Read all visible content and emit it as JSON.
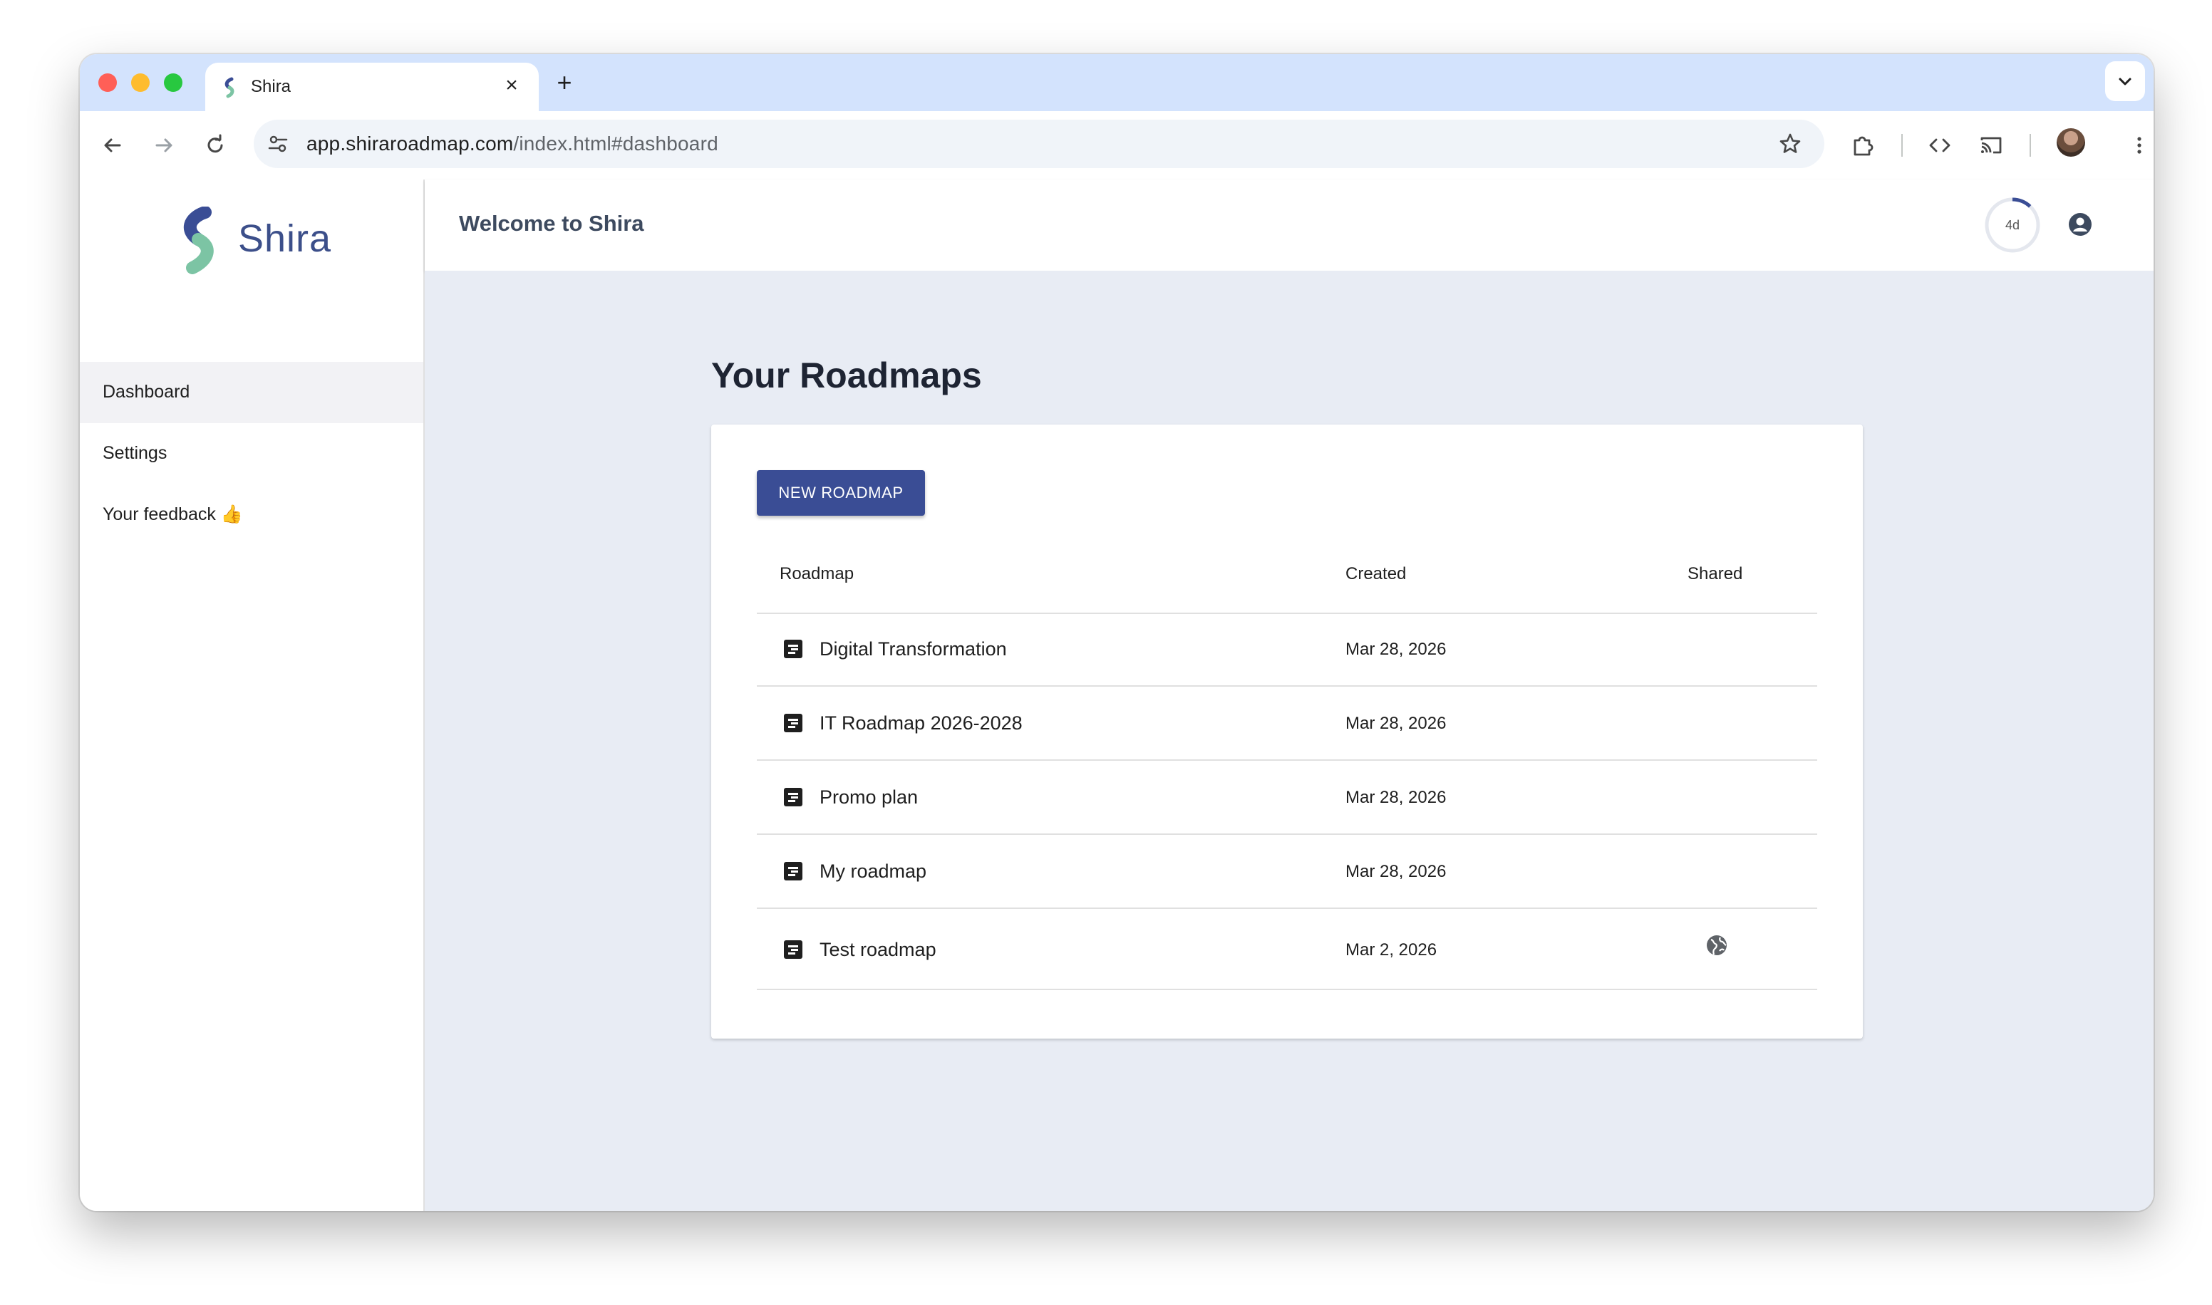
{
  "browser": {
    "tab_title": "Shira",
    "url_domain": "app.shiraroadmap.com",
    "url_path": "/index.html#dashboard"
  },
  "sidebar": {
    "logo_text": "Shira",
    "items": [
      {
        "label": "Dashboard",
        "active": true
      },
      {
        "label": "Settings",
        "active": false
      },
      {
        "label": "Your feedback 👍",
        "active": false
      }
    ]
  },
  "header": {
    "welcome": "Welcome to Shira",
    "timer_label": "4d",
    "timer_fraction": 0.12
  },
  "main": {
    "title": "Your Roadmaps",
    "new_button": "NEW ROADMAP",
    "columns": {
      "roadmap": "Roadmap",
      "created": "Created",
      "shared": "Shared"
    },
    "rows": [
      {
        "name": "Digital Transformation",
        "created": "Mar 28, 2026",
        "shared": false
      },
      {
        "name": "IT Roadmap 2026-2028",
        "created": "Mar 28, 2026",
        "shared": false
      },
      {
        "name": "Promo plan",
        "created": "Mar 28, 2026",
        "shared": false
      },
      {
        "name": "My roadmap",
        "created": "Mar 28, 2026",
        "shared": false
      },
      {
        "name": "Test roadmap",
        "created": "Mar 2, 2026",
        "shared": true
      }
    ]
  },
  "colors": {
    "brand_blue": "#3a4d95",
    "brand_green": "#7cc4a4",
    "background": "#e8ecf4"
  }
}
